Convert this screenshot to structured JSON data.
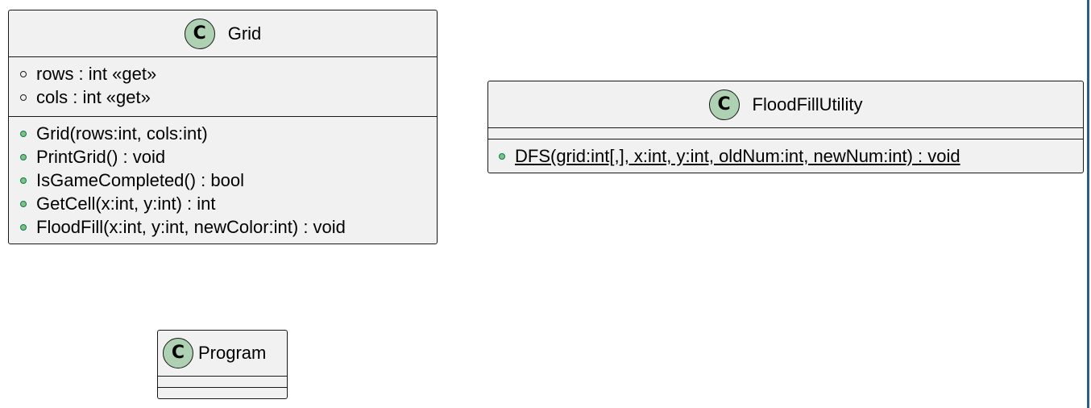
{
  "diagram": {
    "classes": [
      {
        "id": "grid",
        "stereotype_icon": "C",
        "name": "Grid",
        "fields": [
          {
            "text": "rows : int «get»",
            "visibility": "public"
          },
          {
            "text": "cols : int «get»",
            "visibility": "public"
          }
        ],
        "methods": [
          {
            "text": "Grid(rows:int, cols:int)",
            "visibility": "public"
          },
          {
            "text": "PrintGrid() : void",
            "visibility": "public"
          },
          {
            "text": "IsGameCompleted() : bool",
            "visibility": "public"
          },
          {
            "text": "GetCell(x:int, y:int) : int",
            "visibility": "public"
          },
          {
            "text": "FloodFill(x:int, y:int, newColor:int) : void",
            "visibility": "public"
          }
        ]
      },
      {
        "id": "floodfillutility",
        "stereotype_icon": "C",
        "name": "FloodFillUtility",
        "fields": [],
        "methods": [
          {
            "text": "DFS(grid:int[,], x:int, y:int, oldNum:int, newNum:int) : void",
            "visibility": "public",
            "static": true
          }
        ]
      },
      {
        "id": "program",
        "stereotype_icon": "C",
        "name": "Program",
        "fields": [],
        "methods": []
      }
    ]
  },
  "colors": {
    "class_background": "#f1f1f1",
    "class_icon": "#add1b2",
    "method_marker": "#84be84",
    "border": "#181818"
  }
}
